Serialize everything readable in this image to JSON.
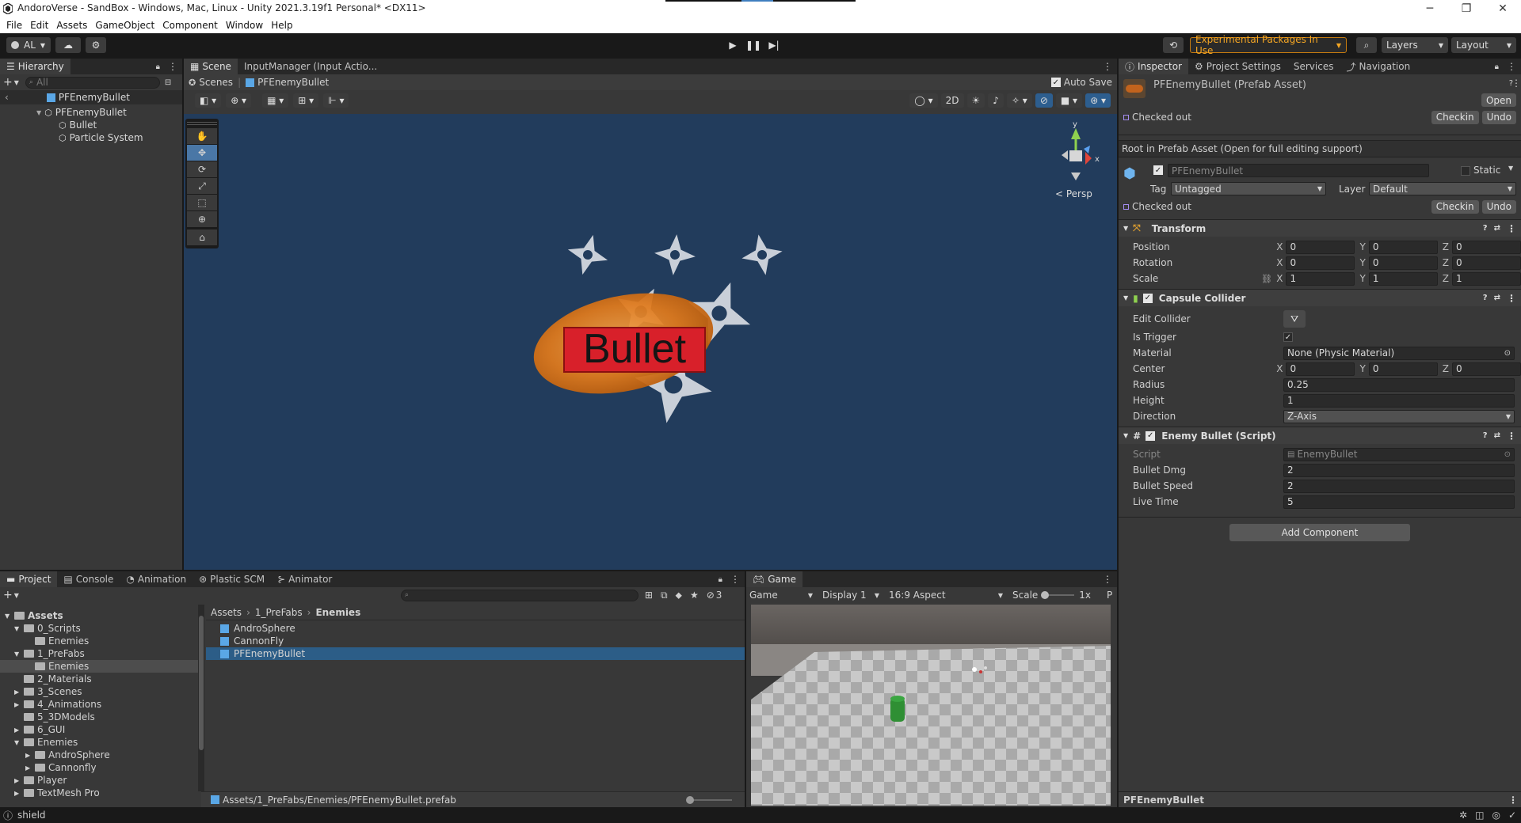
{
  "window": {
    "title": "AndoroVerse - SandBox - Windows, Mac, Linux - Unity 2021.3.19f1 Personal* <DX11>",
    "controls": [
      "─",
      "❐",
      "✕"
    ]
  },
  "menu": [
    "File",
    "Edit",
    "Assets",
    "GameObject",
    "Component",
    "Window",
    "Help"
  ],
  "toolbar": {
    "account": "AL",
    "experimental": "Experimental Packages In Use",
    "layers": "Layers",
    "layout": "Layout"
  },
  "hierarchy": {
    "tab": "Hierarchy",
    "search_placeholder": "All",
    "root": "PFEnemyBullet",
    "items": [
      {
        "label": "PFEnemyBullet",
        "indent": 1
      },
      {
        "label": "Bullet",
        "indent": 2
      },
      {
        "label": "Particle System",
        "indent": 2
      }
    ]
  },
  "scene": {
    "tabs": [
      "Scene",
      "InputManager (Input Actio..."
    ],
    "breadcrumb_scenes": "Scenes",
    "breadcrumb_prefab": "PFEnemyBullet",
    "auto_save": "Auto Save",
    "btn_2d": "2D",
    "persp": "< Persp",
    "bullet_text": "Bullet",
    "gizmo_y": "y",
    "gizmo_x": "x"
  },
  "inspector": {
    "tabs": [
      "Inspector",
      "Project Settings",
      "Services",
      "Navigation"
    ],
    "asset_title": "PFEnemyBullet (Prefab Asset)",
    "open": "Open",
    "checked_out": "Checked out",
    "checkin": "Checkin",
    "undo": "Undo",
    "root_note": "Root in Prefab Asset (Open for full editing support)",
    "object_name": "PFEnemyBullet",
    "static": "Static",
    "tag_label": "Tag",
    "tag_value": "Untagged",
    "layer_label": "Layer",
    "layer_value": "Default",
    "transform": {
      "title": "Transform",
      "rows": [
        {
          "label": "Position",
          "x": "0",
          "y": "0",
          "z": "0"
        },
        {
          "label": "Rotation",
          "x": "0",
          "y": "0",
          "z": "0"
        },
        {
          "label": "Scale",
          "x": "1",
          "y": "1",
          "z": "1"
        }
      ]
    },
    "capsule": {
      "title": "Capsule Collider",
      "edit_collider": "Edit Collider",
      "is_trigger": "Is Trigger",
      "material_label": "Material",
      "material_value": "None (Physic Material)",
      "center_label": "Center",
      "center": {
        "x": "0",
        "y": "0",
        "z": "0"
      },
      "radius_label": "Radius",
      "radius": "0.25",
      "height_label": "Height",
      "height": "1",
      "direction_label": "Direction",
      "direction": "Z-Axis"
    },
    "enemy_bullet": {
      "title": "Enemy Bullet (Script)",
      "script_label": "Script",
      "script_value": "EnemyBullet",
      "bullet_dmg_label": "Bullet Dmg",
      "bullet_dmg": "2",
      "bullet_speed_label": "Bullet Speed",
      "bullet_speed": "2",
      "live_time_label": "Live Time",
      "live_time": "5"
    },
    "add_component": "Add Component",
    "footer": "PFEnemyBullet"
  },
  "project": {
    "tabs": [
      "Project",
      "Console",
      "Animation",
      "Plastic SCM",
      "Animator"
    ],
    "hidden_count": "3",
    "breadcrumb": [
      "Assets",
      "1_PreFabs",
      "Enemies"
    ],
    "tree": [
      {
        "label": "Assets",
        "indent": 0,
        "open": true,
        "bold": true
      },
      {
        "label": "0_Scripts",
        "indent": 1,
        "open": true
      },
      {
        "label": "Enemies",
        "indent": 2
      },
      {
        "label": "1_PreFabs",
        "indent": 1,
        "open": true
      },
      {
        "label": "Enemies",
        "indent": 2,
        "selected": true
      },
      {
        "label": "2_Materials",
        "indent": 1
      },
      {
        "label": "3_Scenes",
        "indent": 1,
        "closed": true
      },
      {
        "label": "4_Animations",
        "indent": 1,
        "closed": true
      },
      {
        "label": "5_3DModels",
        "indent": 1
      },
      {
        "label": "6_GUI",
        "indent": 1,
        "closed": true
      },
      {
        "label": "Enemies",
        "indent": 1,
        "open": true
      },
      {
        "label": "AndroSphere",
        "indent": 2,
        "closed": true
      },
      {
        "label": "Cannonfly",
        "indent": 2,
        "closed": true
      },
      {
        "label": "Player",
        "indent": 1,
        "closed": true
      },
      {
        "label": "TextMesh Pro",
        "indent": 1,
        "closed": true
      }
    ],
    "files": [
      "AndroSphere",
      "CannonFly",
      "PFEnemyBullet"
    ],
    "selected_path": "Assets/1_PreFabs/Enemies/PFEnemyBullet.prefab"
  },
  "game": {
    "tab": "Game",
    "mode": "Game",
    "display": "Display 1",
    "aspect": "16:9 Aspect",
    "scale_label": "Scale",
    "scale_value": "1x",
    "extra": "P"
  },
  "status": {
    "text": "shield"
  }
}
